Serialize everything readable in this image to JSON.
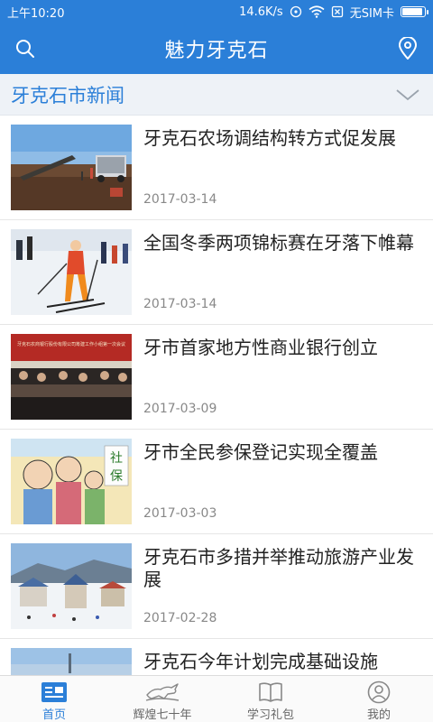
{
  "status_bar": {
    "time": "上午10:20",
    "speed": "14.6K/s",
    "sim": "无SIM卡",
    "battery_level": 0.9
  },
  "header": {
    "title": "魅力牙克石",
    "left_icon": "search-icon",
    "right_icon": "location-pin-icon"
  },
  "section": {
    "title": "牙克石市新闻",
    "toggle_icon": "chevron-down-icon"
  },
  "news": [
    {
      "title": "牙克石农场调结构转方式促发展",
      "date": "2017-03-14"
    },
    {
      "title": "全国冬季两项锦标赛在牙落下帷幕",
      "date": "2017-03-14"
    },
    {
      "title": "牙市首家地方性商业银行创立",
      "date": "2017-03-09"
    },
    {
      "title": "牙市全民参保登记实现全覆盖",
      "date": "2017-03-03"
    },
    {
      "title": "牙克石市多措并举推动旅游产业发展",
      "date": "2017-02-28"
    },
    {
      "title": "牙克石今年计划完成基础设施",
      "date": ""
    }
  ],
  "thumb_captions": {
    "banner": "牙克石农商银行股份有限公司筹建工作小组第一次会议",
    "poster_chars": [
      "社",
      "保"
    ]
  },
  "bottom_nav": [
    {
      "label": "首页",
      "icon": "news-icon",
      "active": true
    },
    {
      "label": "辉煌七十年",
      "icon": "horse-icon",
      "active": false
    },
    {
      "label": "学习礼包",
      "icon": "book-icon",
      "active": false
    },
    {
      "label": "我的",
      "icon": "user-icon",
      "active": false
    }
  ],
  "colors": {
    "brand": "#2b7fd8",
    "section_bg": "#eef2f7"
  }
}
